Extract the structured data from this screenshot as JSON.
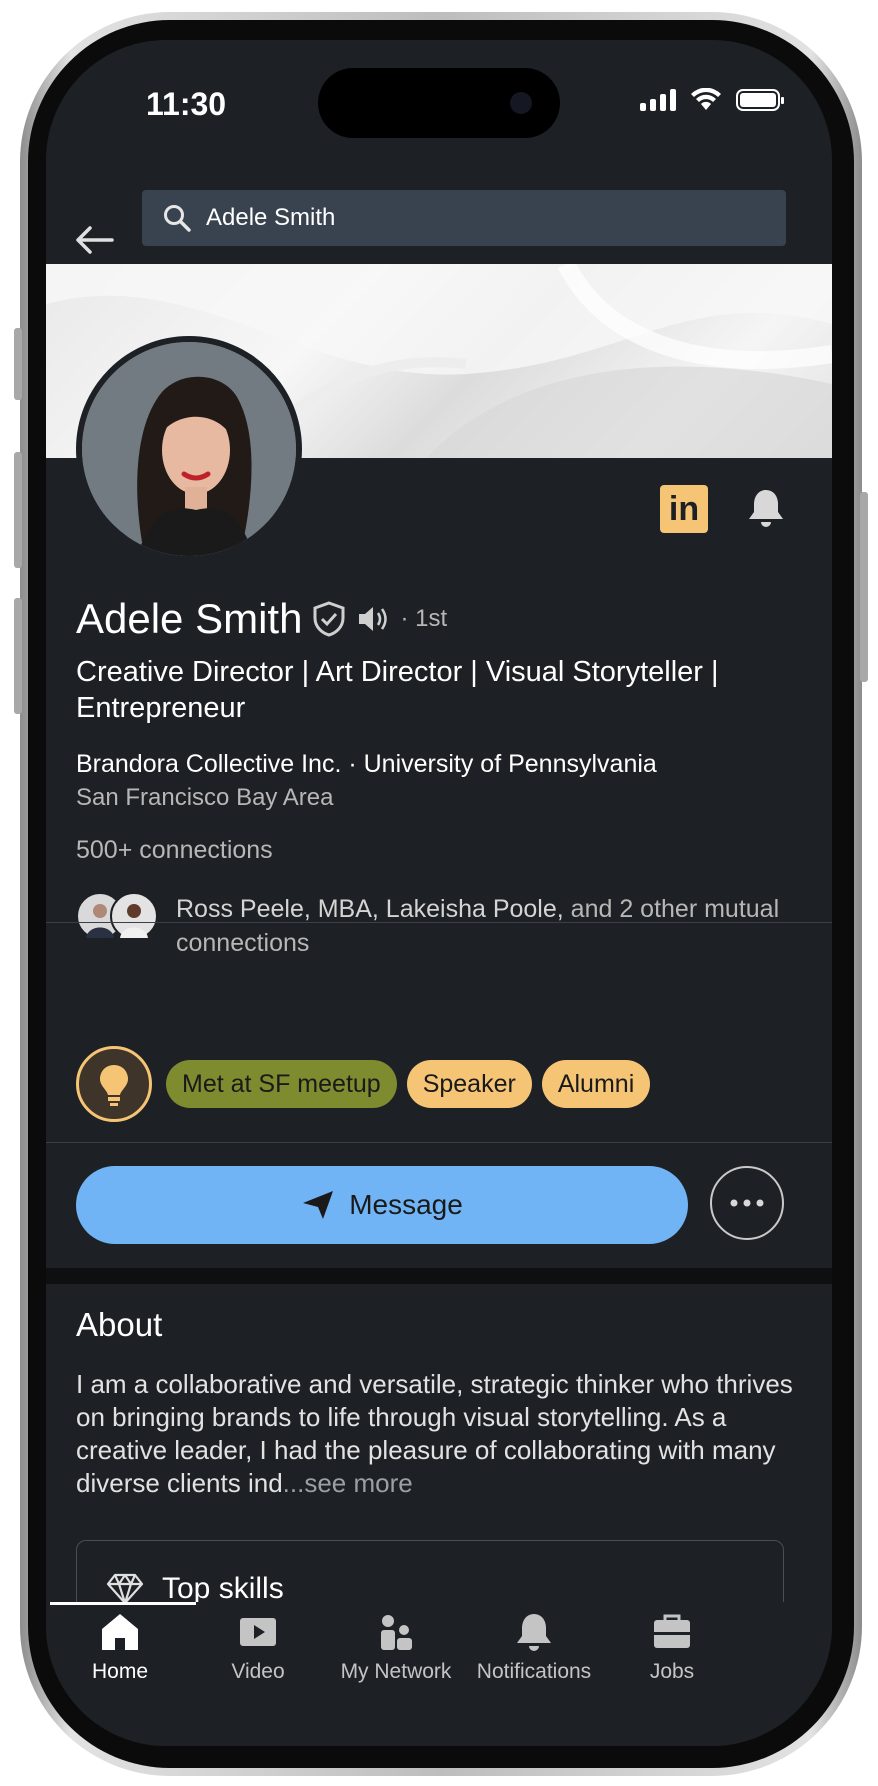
{
  "status_bar": {
    "time": "11:30"
  },
  "search": {
    "value": "Adele Smith"
  },
  "profile": {
    "name": "Adele Smith",
    "degree": "· 1st",
    "headline": "Creative Director | Art Director | Visual Storyteller | Entrepreneur",
    "company_school": "Brandora Collective Inc. · University of Pennsylvania",
    "location": "San Francisco Bay Area",
    "connections": "500+ connections",
    "mutual_names": "Ross Peele, MBA, Lakeisha Poole,",
    "mutual_rest": " and 2 other mutual connections"
  },
  "tags": [
    "Met at SF meetup",
    "Speaker",
    "Alumni"
  ],
  "actions": {
    "message_label": "Message"
  },
  "about": {
    "title": "About",
    "text": "I am a collaborative and versatile, strategic thinker who thrives on bringing brands to life through visual storytelling. As a creative leader, I had the pleasure of collaborating with many diverse clients ind",
    "see_more": "...see more"
  },
  "skills": {
    "title": "Top skills"
  },
  "tabbar": {
    "tabs": [
      {
        "label": "Home",
        "icon": "home-icon",
        "active": true
      },
      {
        "label": "Video",
        "icon": "video-icon"
      },
      {
        "label": "My Network",
        "icon": "network-icon"
      },
      {
        "label": "Notifications",
        "icon": "bell-icon"
      },
      {
        "label": "Jobs",
        "icon": "briefcase-icon"
      }
    ]
  },
  "colors": {
    "background": "#1d2024",
    "accent_blue": "#71b4f5",
    "tag_yellow": "#f5c575",
    "tag_green": "#7e8b2e"
  }
}
